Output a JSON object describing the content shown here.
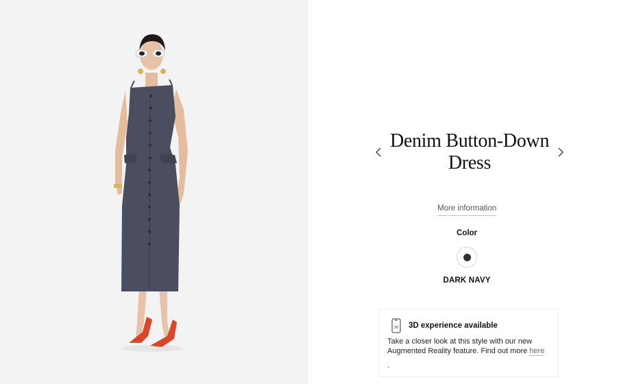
{
  "product": {
    "title": "Denim Button-Down Dress",
    "more_info_label": "More information",
    "prev_icon": "chevron-left-icon",
    "next_icon": "chevron-right-icon"
  },
  "color": {
    "label": "Color",
    "selected_name": "DARK NAVY",
    "swatch_hex": "#2f3136"
  },
  "ar": {
    "icon": "phone-3d-icon",
    "icon_text": "3D",
    "title": "3D experience available",
    "body": "Take a closer look at this style with our new Augmented Reality feature. Find out more",
    "link_label": "here",
    "trailing": "."
  },
  "colors": {
    "image_background": "#f4f3f3",
    "dress": "#4a4e5e",
    "shoes": "#d9462a"
  }
}
